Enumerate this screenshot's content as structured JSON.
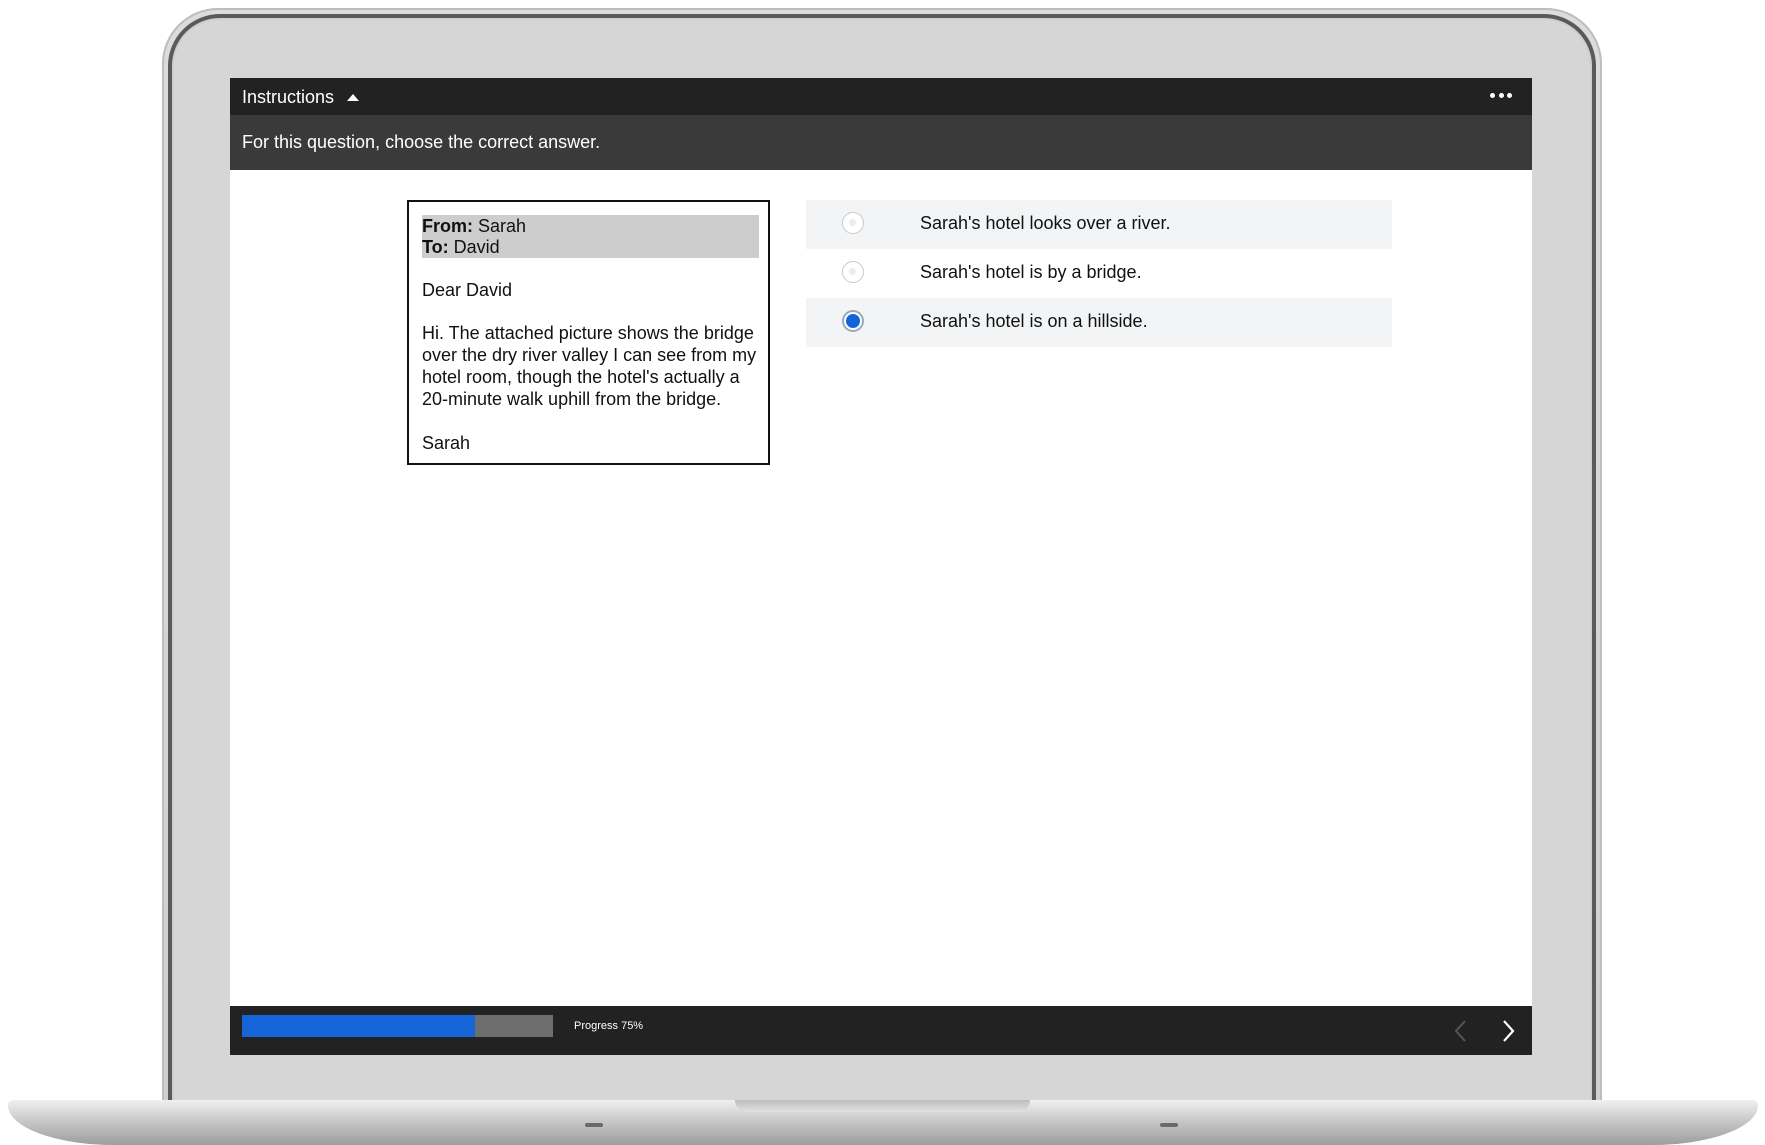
{
  "header": {
    "instructions_label": "Instructions",
    "instruction_text": "For this question, choose the correct answer."
  },
  "email": {
    "from_label": "From:",
    "from_value": " Sarah",
    "to_label": "To:",
    "to_value": " David",
    "greeting": "Dear David",
    "body": "Hi. The attached picture shows the bridge over the dry river valley I can see from my hotel room, though the hotel's actually a 20-minute walk uphill from the bridge.",
    "signature": "Sarah"
  },
  "options": [
    {
      "label": "Sarah's hotel looks over a river.",
      "selected": false
    },
    {
      "label": "Sarah's hotel is by a bridge.",
      "selected": false
    },
    {
      "label": "Sarah's hotel is on a hillside.",
      "selected": true
    }
  ],
  "footer": {
    "progress_text": "Progress 75%",
    "progress_value": 0.75
  },
  "colors": {
    "accent": "#1565d8",
    "topbar": "#222222",
    "instruction_bar": "#3a3a3a"
  },
  "icons": {
    "menu": "more-horizontal-icon",
    "toggle": "caret-up-icon",
    "prev": "chevron-left-icon",
    "next": "chevron-right-icon"
  }
}
